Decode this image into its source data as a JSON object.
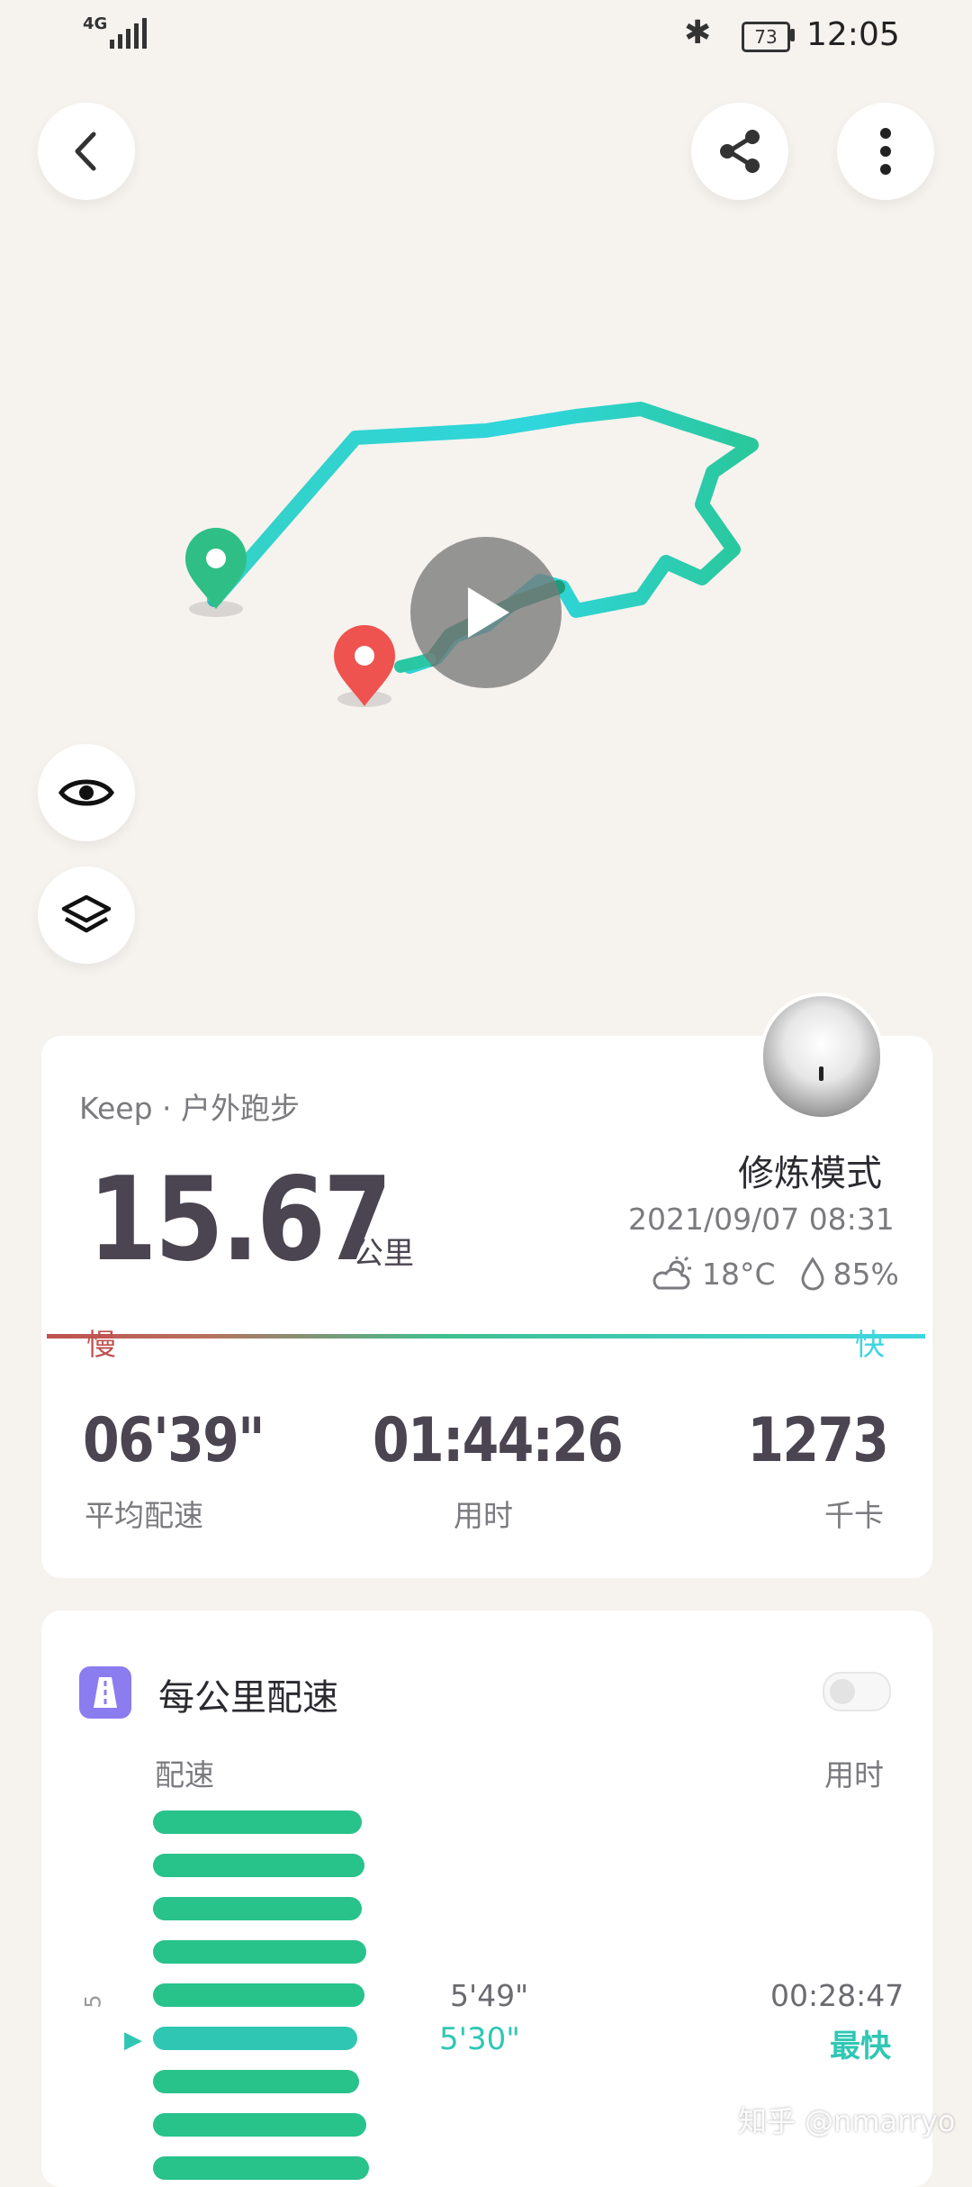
{
  "status_bar": {
    "network": "4G",
    "battery": "73",
    "time": "12:05"
  },
  "map": {
    "icons": [
      "back-icon",
      "share-icon",
      "more-icon",
      "play-icon",
      "eye-icon",
      "layers-icon",
      "start-pin-icon",
      "end-pin-icon"
    ]
  },
  "summary": {
    "source": "Keep · 户外跑步",
    "mode": "修炼模式",
    "distance": "15.67",
    "distance_unit": "公里",
    "datetime": "2021/09/07 08:31",
    "temperature": "18°C",
    "humidity": "85%",
    "slow_label": "慢",
    "fast_label": "快",
    "stats": [
      {
        "value": "06'39\"",
        "label": "平均配速"
      },
      {
        "value": "01:44:26",
        "label": "用时"
      },
      {
        "value": "1273",
        "label": "千卡"
      }
    ]
  },
  "pace_card": {
    "title": "每公里配速",
    "col_pace": "配速",
    "col_time": "用时",
    "row_5_index": "5",
    "row_5_pace": "5'49\"",
    "row_5_time": "00:28:47",
    "row_6_pace": "5'30\"",
    "row_6_badge": "最快",
    "bar_fraction": [
      0.88,
      0.89,
      0.88,
      0.9,
      0.89,
      0.86,
      0.87,
      0.9,
      0.91
    ]
  },
  "watermark": "知乎 @nmarryo",
  "colors": {
    "accent_green": "#28c28b",
    "accent_teal": "#2fc7b4",
    "slow_red": "#c0514f",
    "fast_cyan": "#3dd6e0",
    "text_dark": "#4b4451",
    "purple_icon": "#8b7cf0"
  }
}
